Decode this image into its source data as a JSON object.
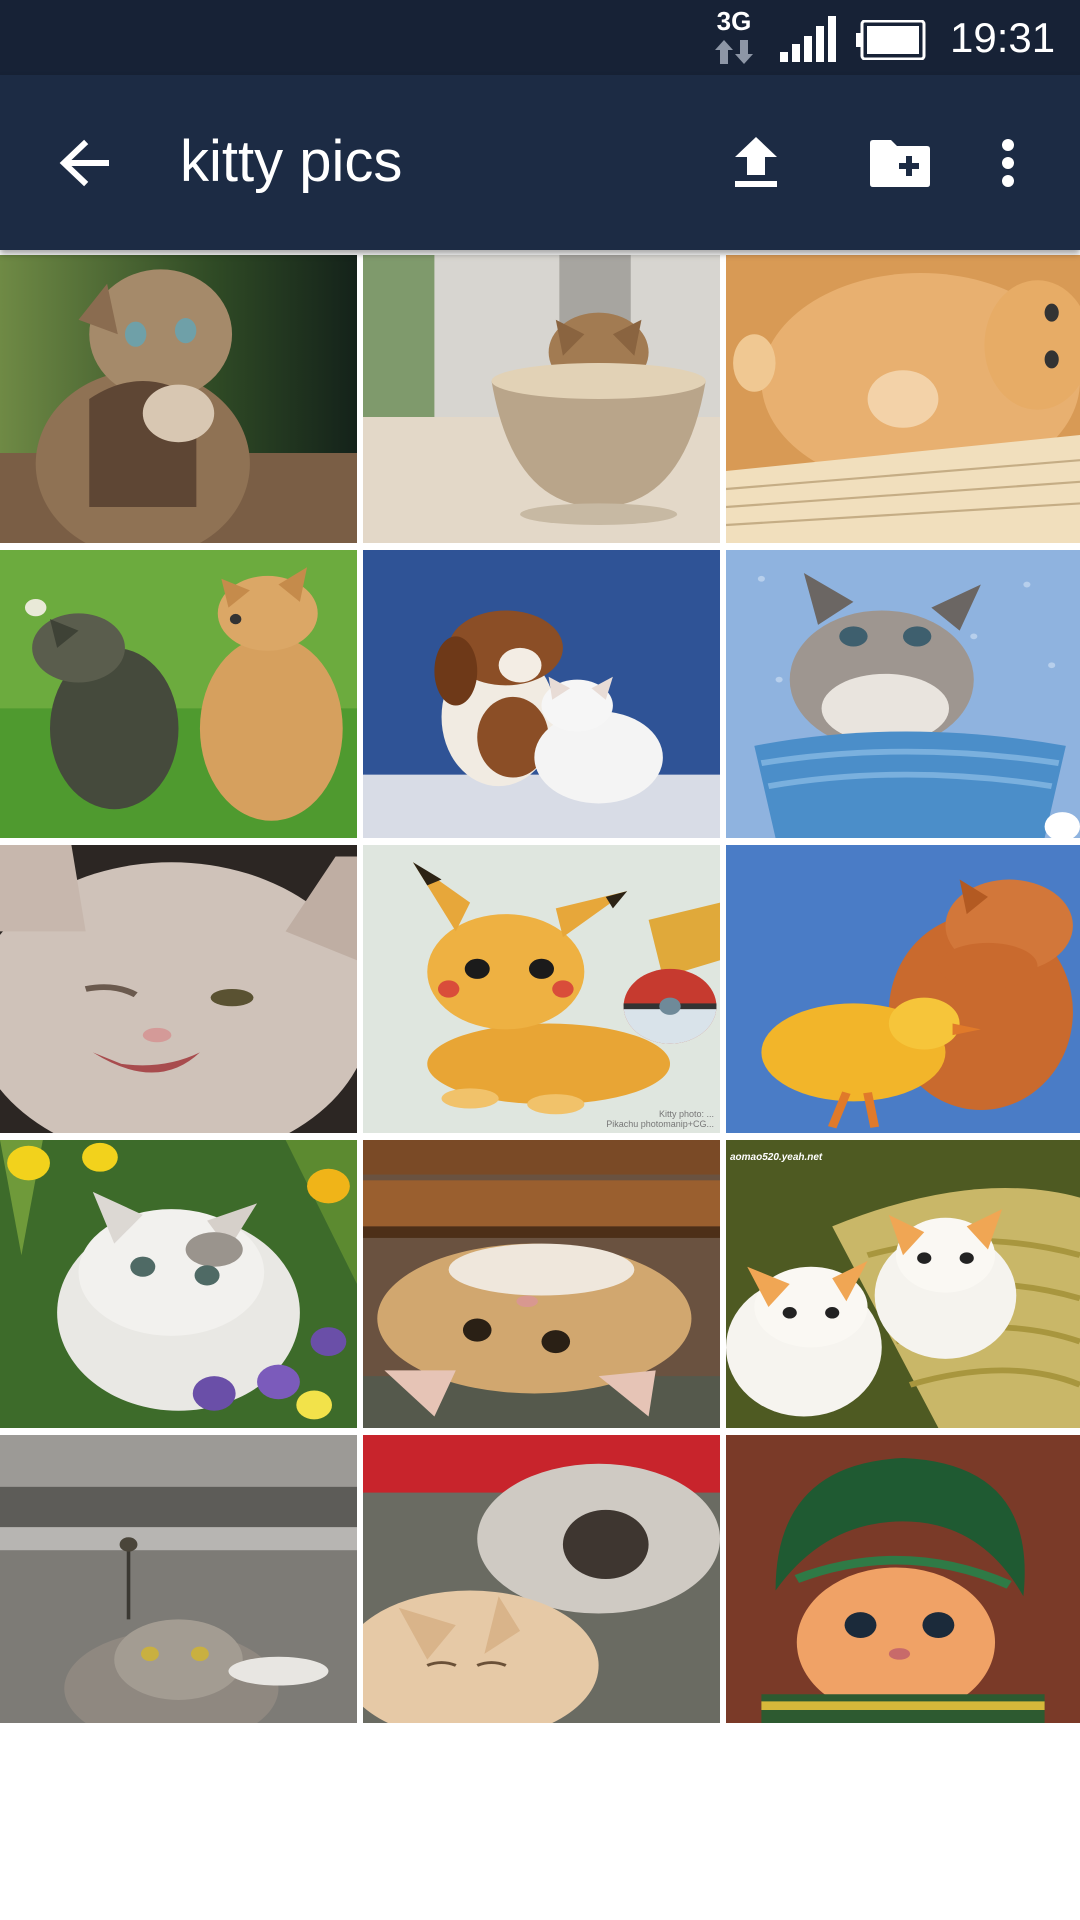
{
  "status_bar": {
    "network": "3G",
    "time": "19:31"
  },
  "toolbar": {
    "title": "kitty pics",
    "back_icon": "arrow-left-icon",
    "upload_icon": "upload-icon",
    "new_folder_icon": "create-new-folder-icon",
    "more_icon": "more-vertical-icon"
  },
  "colors": {
    "status_bar_bg": "#172236",
    "toolbar_bg": "#1c2b44",
    "toolbar_text": "#ffffff",
    "grid_gap": "#ffffff"
  },
  "gallery": {
    "watermarks": {
      "pikachu_line1": "Kitty photo: ...",
      "pikachu_line2": "Pikachu photomanip+CG...",
      "basket": "aomao520.yeah.net"
    }
  }
}
